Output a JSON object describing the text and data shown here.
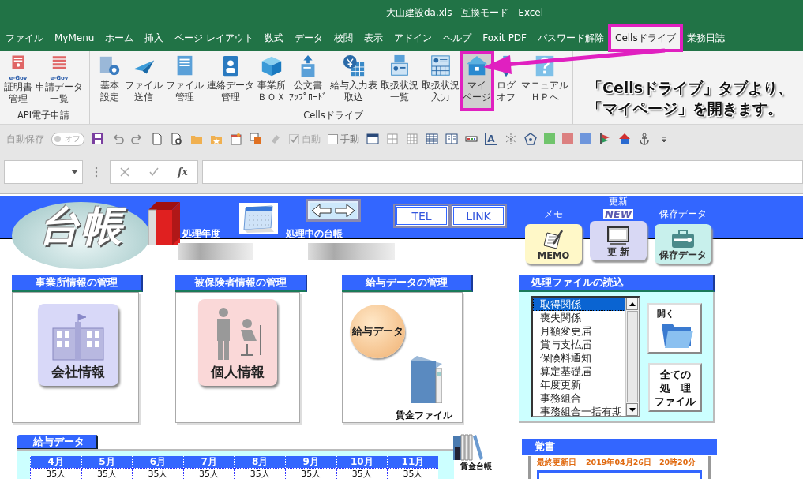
{
  "window": {
    "title": "大山建設da.xls  -  互換モード  -  Excel"
  },
  "ribbon_tabs": [
    {
      "label": "ファイル",
      "selected": false,
      "highlighted": false
    },
    {
      "label": "MyMenu",
      "selected": false,
      "highlighted": false
    },
    {
      "label": "ホーム",
      "selected": false,
      "highlighted": false
    },
    {
      "label": "挿入",
      "selected": false,
      "highlighted": false
    },
    {
      "label": "ページ レイアウト",
      "selected": false,
      "highlighted": false
    },
    {
      "label": "数式",
      "selected": false,
      "highlighted": false
    },
    {
      "label": "データ",
      "selected": false,
      "highlighted": false
    },
    {
      "label": "校閲",
      "selected": false,
      "highlighted": false
    },
    {
      "label": "表示",
      "selected": false,
      "highlighted": false
    },
    {
      "label": "アドイン",
      "selected": false,
      "highlighted": false
    },
    {
      "label": "ヘルプ",
      "selected": false,
      "highlighted": false
    },
    {
      "label": "Foxit PDF",
      "selected": false,
      "highlighted": false
    },
    {
      "label": "パスワード解除",
      "selected": false,
      "highlighted": false
    },
    {
      "label": "Cellsドライブ",
      "selected": true,
      "highlighted": true
    },
    {
      "label": "業務日誌",
      "selected": false,
      "highlighted": false
    }
  ],
  "ribbon_groups": [
    {
      "label": "API電子申請",
      "buttons": [
        {
          "lines": [
            "証明書",
            "管理"
          ],
          "badge": "e-Gov",
          "selected": false,
          "highlighted": false
        },
        {
          "lines": [
            "申請データ",
            "一覧"
          ],
          "badge": "e-Gov",
          "selected": false,
          "highlighted": false
        }
      ]
    },
    {
      "label": "Cellsドライブ",
      "buttons": [
        {
          "lines": [
            "基本",
            "設定"
          ],
          "selected": false,
          "highlighted": false
        },
        {
          "lines": [
            "ファイル",
            "送信"
          ],
          "selected": false,
          "highlighted": false
        },
        {
          "lines": [
            "ファイル",
            "管理"
          ],
          "selected": false,
          "highlighted": false
        },
        {
          "lines": [
            "連絡データ",
            "管理"
          ],
          "selected": false,
          "highlighted": false
        },
        {
          "lines": [
            "事業所",
            "ＢＯＸ"
          ],
          "selected": false,
          "highlighted": false
        },
        {
          "lines": [
            "公文書",
            "ｱｯﾌﾟﾛｰﾄﾞ"
          ],
          "selected": false,
          "highlighted": false
        },
        {
          "lines": [
            "給与入力表",
            "取込"
          ],
          "selected": false,
          "highlighted": false
        },
        {
          "lines": [
            "取扱状況",
            "一覧"
          ],
          "selected": false,
          "highlighted": false
        },
        {
          "lines": [
            "取扱状況",
            "入力"
          ],
          "selected": false,
          "highlighted": false
        },
        {
          "lines": [
            "マイ",
            "ページ"
          ],
          "selected": true,
          "highlighted": true
        },
        {
          "lines": [
            "ログ",
            "オフ"
          ],
          "selected": false,
          "highlighted": false
        },
        {
          "lines": [
            "マニュアル",
            "ＨＰへ"
          ],
          "selected": false,
          "highlighted": false
        }
      ]
    }
  ],
  "annotation": {
    "lines": [
      "「Cellsドライブ」タブより、",
      "「マイページ」を開きます。"
    ]
  },
  "quick_access": {
    "autosave": {
      "label": "自動保存",
      "state": "オフ",
      "on": false
    },
    "checks": [
      {
        "label": "自動",
        "checked": true,
        "disabled": true
      },
      {
        "label": "手動",
        "checked": false,
        "disabled": false
      }
    ],
    "font_button": "A",
    "color_swatches": [
      {
        "color": "#70c46c"
      },
      {
        "color": "#dc8080"
      },
      {
        "color": "#6e96dc"
      }
    ]
  },
  "formula_bar": {
    "function_button": "fx"
  },
  "sheet": {
    "logo": "台帳",
    "fields": [
      {
        "label": "処理年度"
      },
      {
        "label": "処理中の台帳"
      }
    ],
    "link_buttons": [
      "TEL",
      "LINK"
    ],
    "tools": [
      {
        "label": "メモ",
        "caption": "MEMO"
      },
      {
        "label": "更新",
        "badge": "NEW",
        "caption": "更 新"
      },
      {
        "label": "保存データ",
        "caption": "保存データ"
      }
    ],
    "panels": [
      {
        "title": "事業所情報の管理",
        "tile": "会社情報"
      },
      {
        "title": "被保険者情報の管理",
        "tile": "個人情報"
      },
      {
        "title": "給与データの管理",
        "tile": "給与データ",
        "file": "賃金ファイル"
      }
    ],
    "file_loader": {
      "title": "処理ファイルの読込",
      "items": [
        {
          "label": "取得関係",
          "selected": true
        },
        {
          "label": "喪失関係",
          "selected": false
        },
        {
          "label": "月額変更届",
          "selected": false
        },
        {
          "label": "賞与支払届",
          "selected": false
        },
        {
          "label": "保険料通知",
          "selected": false
        },
        {
          "label": "算定基礎届",
          "selected": false
        },
        {
          "label": "年度更新",
          "selected": false
        },
        {
          "label": "事務組合",
          "selected": false
        },
        {
          "label": "事務組合一括有期",
          "selected": false
        }
      ],
      "open_button": "開く",
      "all_button": [
        "全ての",
        "処　理",
        "ファイル"
      ]
    },
    "payroll": {
      "title": "給与データ",
      "months": [
        "4月",
        "5月",
        "6月",
        "7月",
        "8月",
        "9月",
        "10月",
        "11月"
      ],
      "counts": [
        "35人",
        "35人",
        "35人",
        "35人",
        "35人",
        "35人",
        "35人",
        "35人"
      ]
    },
    "ledger": {
      "label": "賃金台帳"
    },
    "memo": {
      "title": "覚書",
      "updated_label": "最終更新日",
      "updated_value": "2019年04月26日　20時20分"
    }
  }
}
